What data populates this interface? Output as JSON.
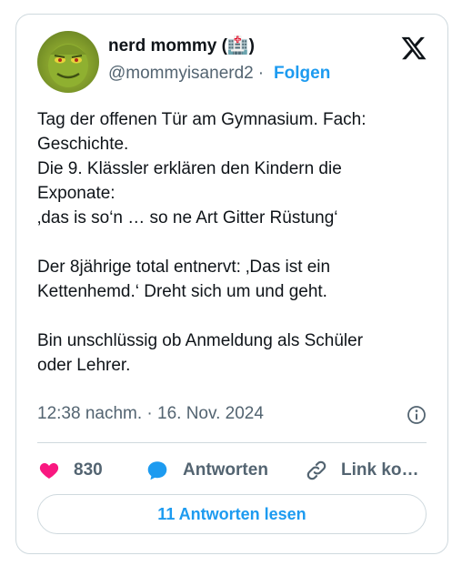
{
  "user": {
    "name": "nerd mommy (🏥)",
    "handle": "@mommyisanerd2",
    "separator": "·",
    "follow_label": "Folgen"
  },
  "tweet": {
    "text": "Tag der offenen Tür am Gymnasium. Fach:\nGeschichte.\nDie 9. Klässler erklären den Kindern die\nExponate:\n‚das is so‘n … so ne Art Gitter Rüstung‘\n\nDer 8jährige total entnervt: ‚Das ist ein\nKettenhemd.‘ Dreht sich um und geht.\n\nBin unschlüssig ob Anmeldung als Schüler\noder Lehrer.",
    "timestamp": "12:38 nachm. · 16. Nov. 2024"
  },
  "actions": {
    "like_count": "830",
    "reply_label": "Antworten",
    "link_label": "Link ko…"
  },
  "read_replies_label": "11 Antworten lesen",
  "icons": {
    "like": "heart-icon",
    "reply": "speech-bubble-icon",
    "link": "link-icon",
    "info": "info-icon",
    "brand": "x-logo-icon"
  },
  "colors": {
    "accent": "#1d9bf0",
    "like": "#f91880",
    "text": "#0f1419",
    "muted": "#536471",
    "border": "#cfd9de"
  }
}
